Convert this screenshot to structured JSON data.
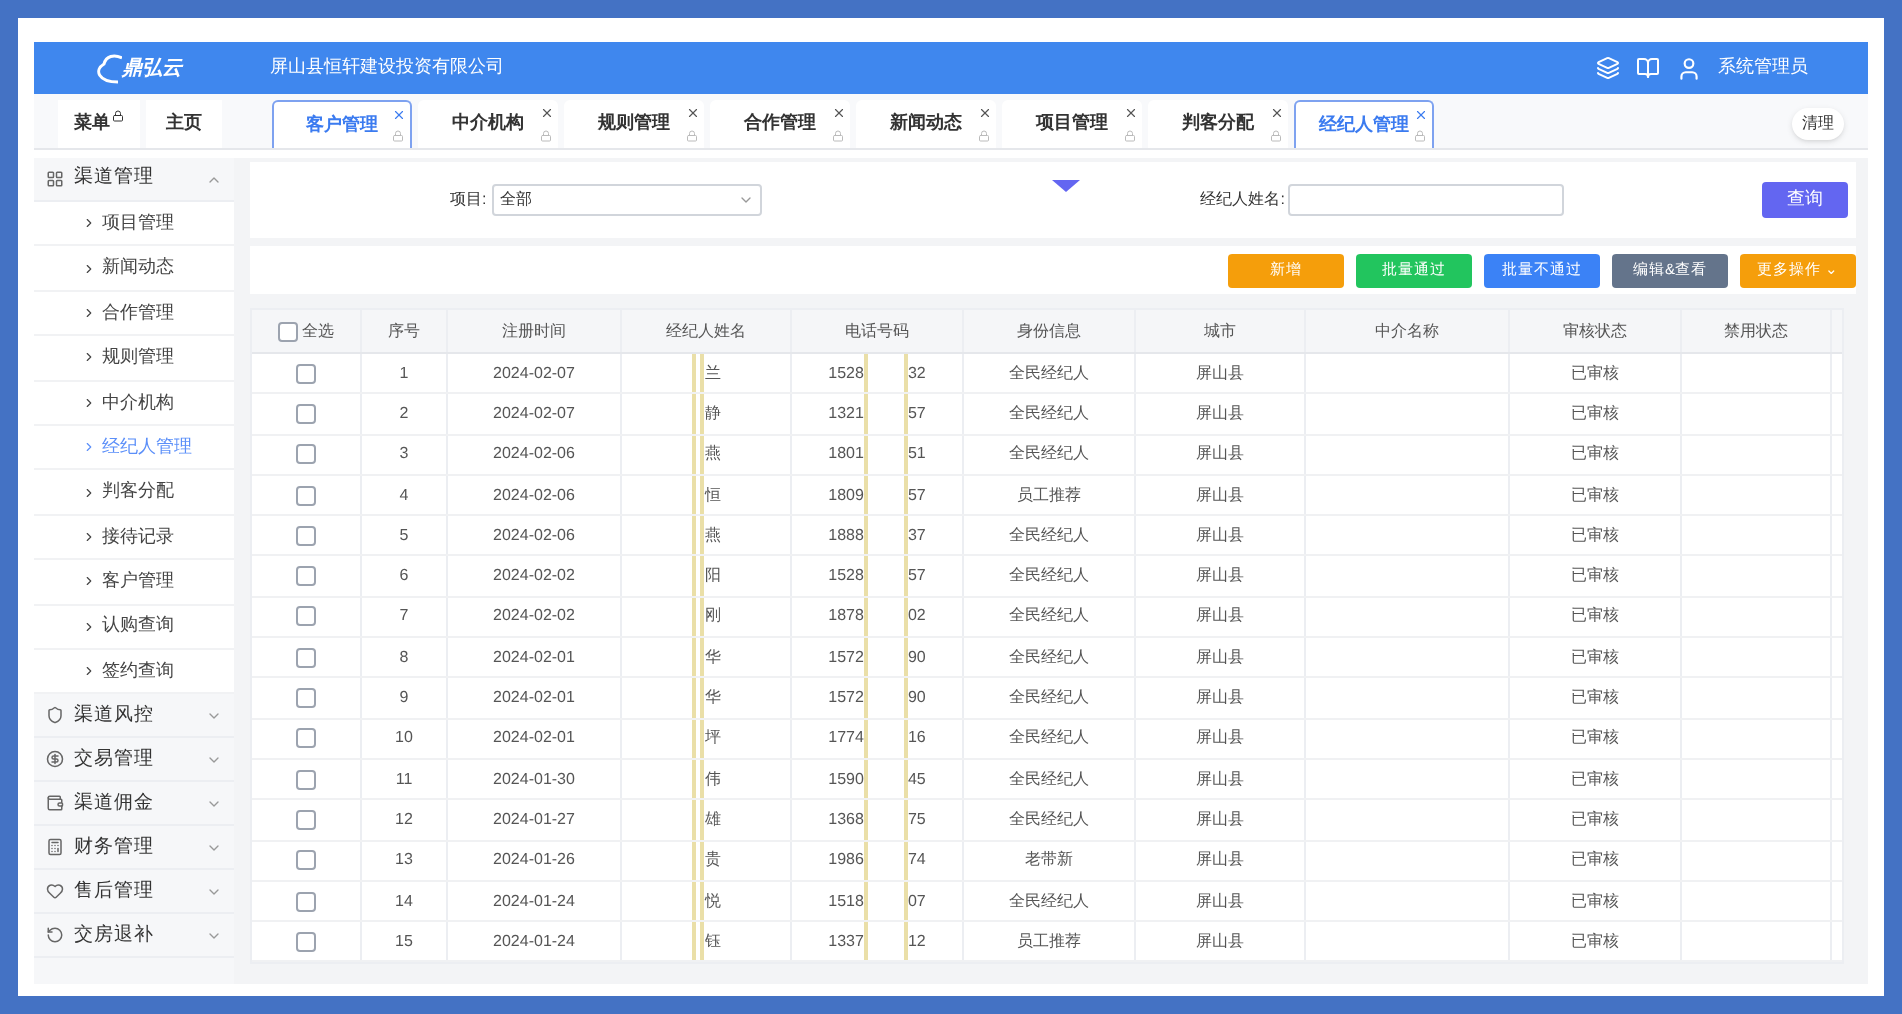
{
  "header": {
    "logo": "鼎弘云",
    "company": "屏山县恒轩建设投资有限公司",
    "user": "系统管理员"
  },
  "nav": {
    "menu": "菜单",
    "home": "主页"
  },
  "tabs": [
    {
      "label": "客户管理",
      "selected": true
    },
    {
      "label": "中介机构",
      "selected": false
    },
    {
      "label": "规则管理",
      "selected": false
    },
    {
      "label": "合作管理",
      "selected": false
    },
    {
      "label": "新闻动态",
      "selected": false
    },
    {
      "label": "项目管理",
      "selected": false
    },
    {
      "label": "判客分配",
      "selected": false
    },
    {
      "label": "经纪人管理",
      "selected": true
    }
  ],
  "clear_button": "清理",
  "sidebar": {
    "items": [
      {
        "label": "渠道管理",
        "expanded": true,
        "children": [
          {
            "label": "项目管理",
            "selected": false
          },
          {
            "label": "新闻动态",
            "selected": false
          },
          {
            "label": "合作管理",
            "selected": false
          },
          {
            "label": "规则管理",
            "selected": false
          },
          {
            "label": "中介机构",
            "selected": false
          },
          {
            "label": "经纪人管理",
            "selected": true
          },
          {
            "label": "判客分配",
            "selected": false
          },
          {
            "label": "接待记录",
            "selected": false
          },
          {
            "label": "客户管理",
            "selected": false
          },
          {
            "label": "认购查询",
            "selected": false
          },
          {
            "label": "签约查询",
            "selected": false
          }
        ]
      },
      {
        "label": "渠道风控",
        "expanded": false
      },
      {
        "label": "交易管理",
        "expanded": false
      },
      {
        "label": "渠道佣金",
        "expanded": false
      },
      {
        "label": "财务管理",
        "expanded": false
      },
      {
        "label": "售后管理",
        "expanded": false
      },
      {
        "label": "交房退补",
        "expanded": false
      }
    ]
  },
  "filters": {
    "project_label": "项目:",
    "project_value": "全部",
    "name_label": "经纪人姓名:",
    "query_button": "查询"
  },
  "actions": [
    {
      "label": "新增",
      "color": "#f59e0b"
    },
    {
      "label": "批量通过",
      "color": "#22c55e"
    },
    {
      "label": "批量不通过",
      "color": "#3b82f6"
    },
    {
      "label": "编辑&查看",
      "color": "#64748b"
    },
    {
      "label": "更多操作 ⌄",
      "color": "#f59e0b"
    }
  ],
  "table": {
    "select_all": {
      "label": "全选",
      "checked": false
    },
    "columns": [
      "序号",
      "注册时间",
      "经纪人姓名",
      "电话号码",
      "身份信息",
      "城市",
      "中介名称",
      "审核状态",
      "禁用状态"
    ],
    "rows": [
      {
        "checked": false,
        "no": "1",
        "date": "2024-02-07",
        "name": "兰",
        "phone_start": "1528",
        "phone_end": "32",
        "identity": "全民经纪人",
        "city": "屏山县",
        "review": "已审核",
        "redacted": true
      },
      {
        "checked": false,
        "no": "2",
        "date": "2024-02-07",
        "name": "静",
        "phone_start": "1321",
        "phone_end": "57",
        "identity": "全民经纪人",
        "city": "屏山县",
        "review": "已审核",
        "redacted": true
      },
      {
        "checked": false,
        "no": "3",
        "date": "2024-02-06",
        "name": "燕",
        "phone_start": "1801",
        "phone_end": "51",
        "identity": "全民经纪人",
        "city": "屏山县",
        "review": "已审核",
        "redacted": true
      },
      {
        "checked": false,
        "no": "4",
        "date": "2024-02-06",
        "name": "恒",
        "phone_start": "1809",
        "phone_end": "57",
        "identity": "员工推荐",
        "city": "屏山县",
        "review": "已审核",
        "redacted": true
      },
      {
        "checked": false,
        "no": "5",
        "date": "2024-02-06",
        "name": "燕",
        "phone_start": "1888",
        "phone_end": "37",
        "identity": "全民经纪人",
        "city": "屏山县",
        "review": "已审核",
        "redacted": true
      },
      {
        "checked": false,
        "no": "6",
        "date": "2024-02-02",
        "name": "阳",
        "phone_start": "1528",
        "phone_end": "57",
        "identity": "全民经纪人",
        "city": "屏山县",
        "review": "已审核",
        "redacted": true
      },
      {
        "checked": false,
        "no": "7",
        "date": "2024-02-02",
        "name": "刚",
        "phone_start": "1878",
        "phone_end": "02",
        "identity": "全民经纪人",
        "city": "屏山县",
        "review": "已审核",
        "redacted": true
      },
      {
        "checked": false,
        "no": "8",
        "date": "2024-02-01",
        "name": "华",
        "phone_start": "1572",
        "phone_end": "90",
        "identity": "全民经纪人",
        "city": "屏山县",
        "review": "已审核",
        "redacted": true
      },
      {
        "checked": false,
        "no": "9",
        "date": "2024-02-01",
        "name": "华",
        "phone_start": "1572",
        "phone_end": "90",
        "identity": "全民经纪人",
        "city": "屏山县",
        "review": "已审核",
        "redacted": true
      },
      {
        "checked": false,
        "no": "10",
        "date": "2024-02-01",
        "name": "坪",
        "phone_start": "1774",
        "phone_end": "16",
        "identity": "全民经纪人",
        "city": "屏山县",
        "review": "已审核",
        "redacted": true
      },
      {
        "checked": false,
        "no": "11",
        "date": "2024-01-30",
        "name": "伟",
        "phone_start": "1590",
        "phone_end": "45",
        "identity": "全民经纪人",
        "city": "屏山县",
        "review": "已审核",
        "redacted": true
      },
      {
        "checked": false,
        "no": "12",
        "date": "2024-01-27",
        "name": "雄",
        "phone_start": "1368",
        "phone_end": "75",
        "identity": "全民经纪人",
        "city": "屏山县",
        "review": "已审核",
        "redacted": true
      },
      {
        "checked": false,
        "no": "13",
        "date": "2024-01-26",
        "name": "贵",
        "phone_start": "1986",
        "phone_end": "74",
        "identity": "老带新",
        "city": "屏山县",
        "review": "已审核",
        "redacted": true
      },
      {
        "checked": false,
        "no": "14",
        "date": "2024-01-24",
        "name": "悦",
        "phone_start": "1518",
        "phone_end": "07",
        "identity": "全民经纪人",
        "city": "屏山县",
        "review": "已审核",
        "redacted": true
      },
      {
        "checked": false,
        "no": "15",
        "date": "2024-01-24",
        "name": "钰",
        "phone_start": "1337",
        "phone_end": "12",
        "identity": "员工推荐",
        "city": "屏山县",
        "review": "已审核",
        "redacted": true
      }
    ]
  }
}
